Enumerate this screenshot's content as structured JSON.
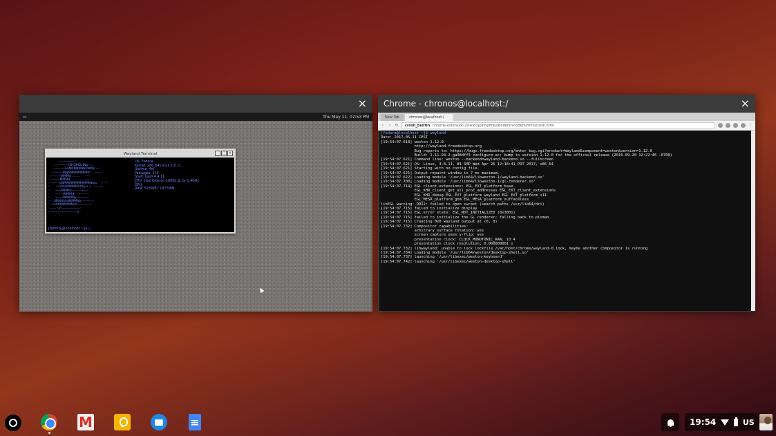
{
  "colors": {
    "wallpaper_mid": "#93361c",
    "window_frame": "#3b3b3b",
    "terminal_bg": "#101010",
    "prompt_blue": "#8aa7ff"
  },
  "left_window": {
    "close_label": "×",
    "panel_clock": "Thu May 11, 07:53 PM",
    "terminal_title": "Wayland Terminal",
    "ascii_art": "         .:-------------::.\n     .:-----------/SHGMDHNp--:.\n   .:----------oaNNNNNNNPNMB ---:\n  .:---------MNNNMMMMMPP     ----:\n :---------MMMd ........     ----:\n:---------MMMd ........     .----:\n:------   oNMMMMMMMMMMbho    .----:\n:-     .+shhhMMMMhhhy++  .------/\n:-    -----/MMMd--------------:\n:-    -------/MMMd------------:\n:-    -------/MMMMy----------:\n:-- :dMNdhhdNMMNo-----------:\n:---:sdNMMMMNds:-----------:\n:------:://:----------------:\n:-----------------------://",
    "info_lines": [
      "OS: Fedora",
      "Kernel: x86_64 Linux 3.8.11",
      "Uptime: 4m",
      "Packages: 519",
      "Shell: bash 4.4.11",
      "CPU: Intel Celeron 1005b @ 2x 1.4GHz",
      "GPU:",
      "RAM: 513MiB / 1877MiB"
    ],
    "prompt": "[fedora@localhost ~]$ ▯"
  },
  "right_window": {
    "title": "Chrome - chronos@localhost:/",
    "close_label": "×",
    "tabs": [
      "New Tab",
      "chronos@localhost:/"
    ],
    "omnibox_chip": "crosh_builtin",
    "omnibox_url": "chrome-extension://nkoccljplnhpfmbjdsodenminodem/html/crosh.html",
    "terminal_lines": [
      "[fedora@localhost ~]$ wayland",
      "Date: 2017-05-11 CEST",
      "[19:54:07.618] weston 1.12.0",
      "               http://wayland.freedesktop.org",
      "               Bug reports to: https://bugs.freedesktop.org/enter_bug.cgi?product=Wayland&component=weston&version=1.12.0",
      "               Build: 1.11.94-2-ga08dff5 configure.ac: bump to version 1.12.0 for the official release (2016-09-20 12:22:46 -0700)",
      "[19:54:07.621] Command line: weston --backend=wayland-backend.so --fullscreen",
      "[19:54:07.621] OS: Linux, 3.8.11, #1 SMP Wed Apr 26 12:18:41 PDT 2017, x86_64",
      "[19:54:07.621] Starting with no config file.",
      "[19:54:07.621] Output repaint window is 7 ms maximum.",
      "[19:54:07.622] Loading module '/usr/lib64/libweston-1/wayland-backend.so'",
      "[19:54:07.700] Loading module '/usr/lib64/libweston-1/gl-renderer.so'",
      "[19:54:07.714] EGL client extensions: EGL_EXT_platform_base",
      "               EGL_KHR_client_get_all_proc_addresses EGL_EXT_client_extensions",
      "               EGL_KHR_debug EGL_EXT_platform_wayland EGL_EXT_platform_x11",
      "               EGL_MESA_platform_gbm EGL_MESA_platform_surfaceless",
      "libEGL warning: DRI2: failed to open swrast (search paths /usr/lib64/dri)",
      "[19:54:07.715] failed to initialize display",
      "[19:54:07.715] EGL error state: EGL_NOT_INITIALIZED (0x3001)",
      "[19:54:07.715] failed to initialize the GL renderer; falling back to pixman.",
      "[19:54:07.715] Creating 0x0 wayland output at (0, 0)",
      "[19:54:07.732] Compositor capabilities:",
      "               arbitrary surface rotation: yes",
      "               screen capture uses y-flip: yes",
      "               presentation clock: CLOCK_MONOTONIC_RAW, id 4",
      "               presentation clock resolution: 0.000000001 s",
      "[19:54:07.732] libwayland: unable to lock lockfile /var/host/chrome/wayland-0.lock, maybe another compositor is running",
      "[19:54:07.734] Loading module '/usr/lib64/weston/desktop-shell.so'",
      "[19:54:07.737] launching '/usr/libexec/weston-keyboard'",
      "[19:54:07.742] launching '/usr/libexec/weston-desktop-shell'"
    ]
  },
  "shelf": {
    "apps": [
      "chrome-icon",
      "gmail-icon",
      "keep-icon",
      "files-icon",
      "docs-icon"
    ]
  },
  "tray": {
    "time": "19:54",
    "language": "US"
  }
}
